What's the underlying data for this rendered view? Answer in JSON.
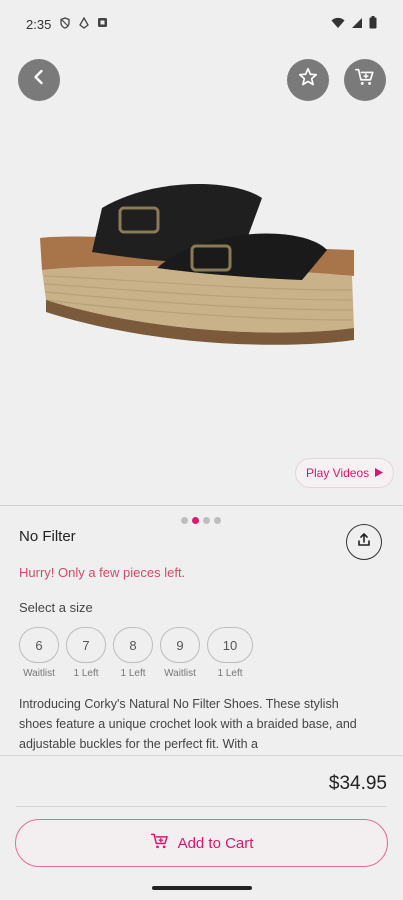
{
  "status_bar": {
    "time": "2:35",
    "icons": [
      "shield-icon",
      "drive-icon",
      "app-icon",
      "wifi-icon",
      "signal-icon",
      "battery-icon"
    ]
  },
  "header": {
    "back_icon": "chevron-left-icon",
    "favorite_icon": "star-icon",
    "cart_icon": "cart-icon"
  },
  "gallery": {
    "image": "black-sandal-platform-shoe",
    "dots_count": 4,
    "active_dot": 1,
    "play_videos_label": "Play Videos"
  },
  "product": {
    "name": "No Filter",
    "urgency": "Hurry! Only a few pieces left.",
    "size_label": "Select a size",
    "sizes": [
      {
        "size": "6",
        "stock": "Waitlist"
      },
      {
        "size": "7",
        "stock": "1 Left"
      },
      {
        "size": "8",
        "stock": "1 Left"
      },
      {
        "size": "9",
        "stock": "Waitlist"
      },
      {
        "size": "10",
        "stock": "1 Left"
      }
    ],
    "description": "Introducing Corky's Natural No Filter Shoes. These stylish shoes feature a unique crochet look with a braided base, and adjustable buckles for the perfect fit. With a",
    "price": "$34.95"
  },
  "footer": {
    "add_to_cart_label": "Add to Cart"
  },
  "colors": {
    "accent": "#d8186f",
    "urgency": "#d24a6a",
    "button_bg": "#7a7a7a"
  }
}
